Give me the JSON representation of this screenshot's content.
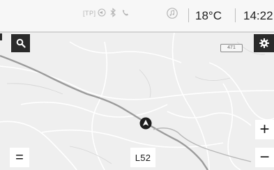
{
  "status_bar": {
    "tp_label": "TP",
    "temperature": "18°C",
    "time": "14:22",
    "icons": [
      "traffic-program-icon",
      "speaker-icon",
      "bluetooth-icon",
      "phone-icon",
      "music-icon"
    ]
  },
  "map": {
    "road_badge": "471",
    "current_road": "L52",
    "controls": {
      "search_icon": "search-icon",
      "settings_icon": "gear-icon",
      "zoom_in_label": "+",
      "zoom_out_label": "−",
      "menu_label": "="
    }
  },
  "colors": {
    "status_background": "#f7f7f7",
    "map_background": "#efefef",
    "button_dark": "#2a2a2a",
    "road": "#9b9b9b"
  }
}
